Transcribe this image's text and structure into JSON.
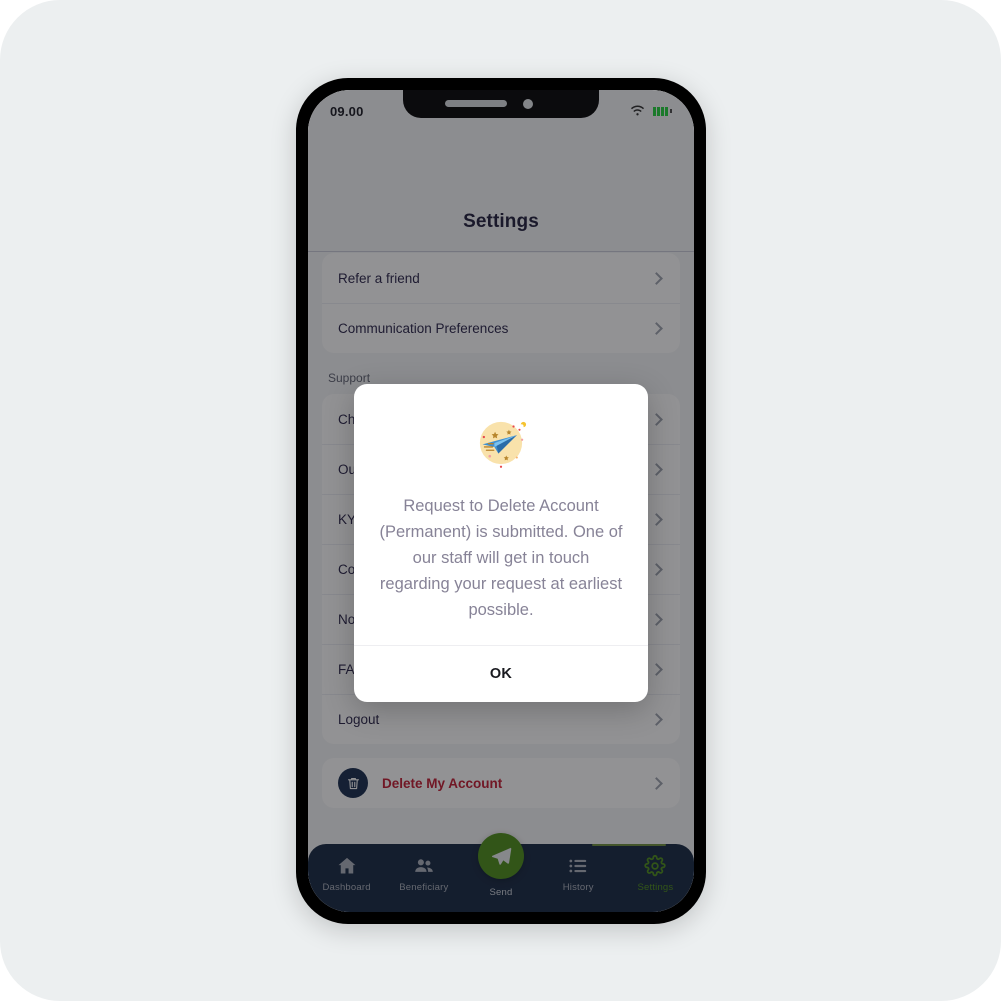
{
  "status_bar": {
    "time": "09.00",
    "wifi_icon": "wifi-icon",
    "battery_icon": "battery-icon"
  },
  "header": {
    "title": "Settings"
  },
  "settings": {
    "group_top": [
      {
        "label": "Refer a friend",
        "icon": "chevron-right-icon"
      },
      {
        "label": "Communication Preferences",
        "icon": "chevron-right-icon"
      }
    ],
    "section_label": "Support",
    "group_support": [
      {
        "label": "Ch",
        "icon": "chevron-right-icon"
      },
      {
        "label": "Ou",
        "icon": "chevron-right-icon"
      },
      {
        "label": "KY",
        "icon": "chevron-right-icon"
      },
      {
        "label": "Co",
        "icon": "chevron-right-icon"
      },
      {
        "label": "No",
        "icon": "chevron-right-icon"
      },
      {
        "label": "FA",
        "icon": "chevron-right-icon"
      },
      {
        "label": "Logout",
        "icon": "chevron-right-icon"
      }
    ],
    "delete_account": {
      "label": "Delete My Account",
      "icon": "trash-icon",
      "chevron": "chevron-right-icon",
      "color": "#c0182e",
      "badge_color": "#13284a"
    }
  },
  "dialog": {
    "illustration": "paper-plane-illustration",
    "message": "Request to Delete Account (Permanent) is submitted. One of our staff will get in touch regarding your request at earliest possible.",
    "ok_label": "OK"
  },
  "bottom_nav": {
    "active_color": "#4a8d16",
    "items": [
      {
        "label": "Dashboard",
        "icon": "home-icon",
        "active": false
      },
      {
        "label": "Beneficiary",
        "icon": "people-icon",
        "active": false
      },
      {
        "label": "Send",
        "icon": "send-icon",
        "active": false
      },
      {
        "label": "History",
        "icon": "list-icon",
        "active": false
      },
      {
        "label": "Settings",
        "icon": "gear-icon",
        "active": true
      }
    ]
  }
}
